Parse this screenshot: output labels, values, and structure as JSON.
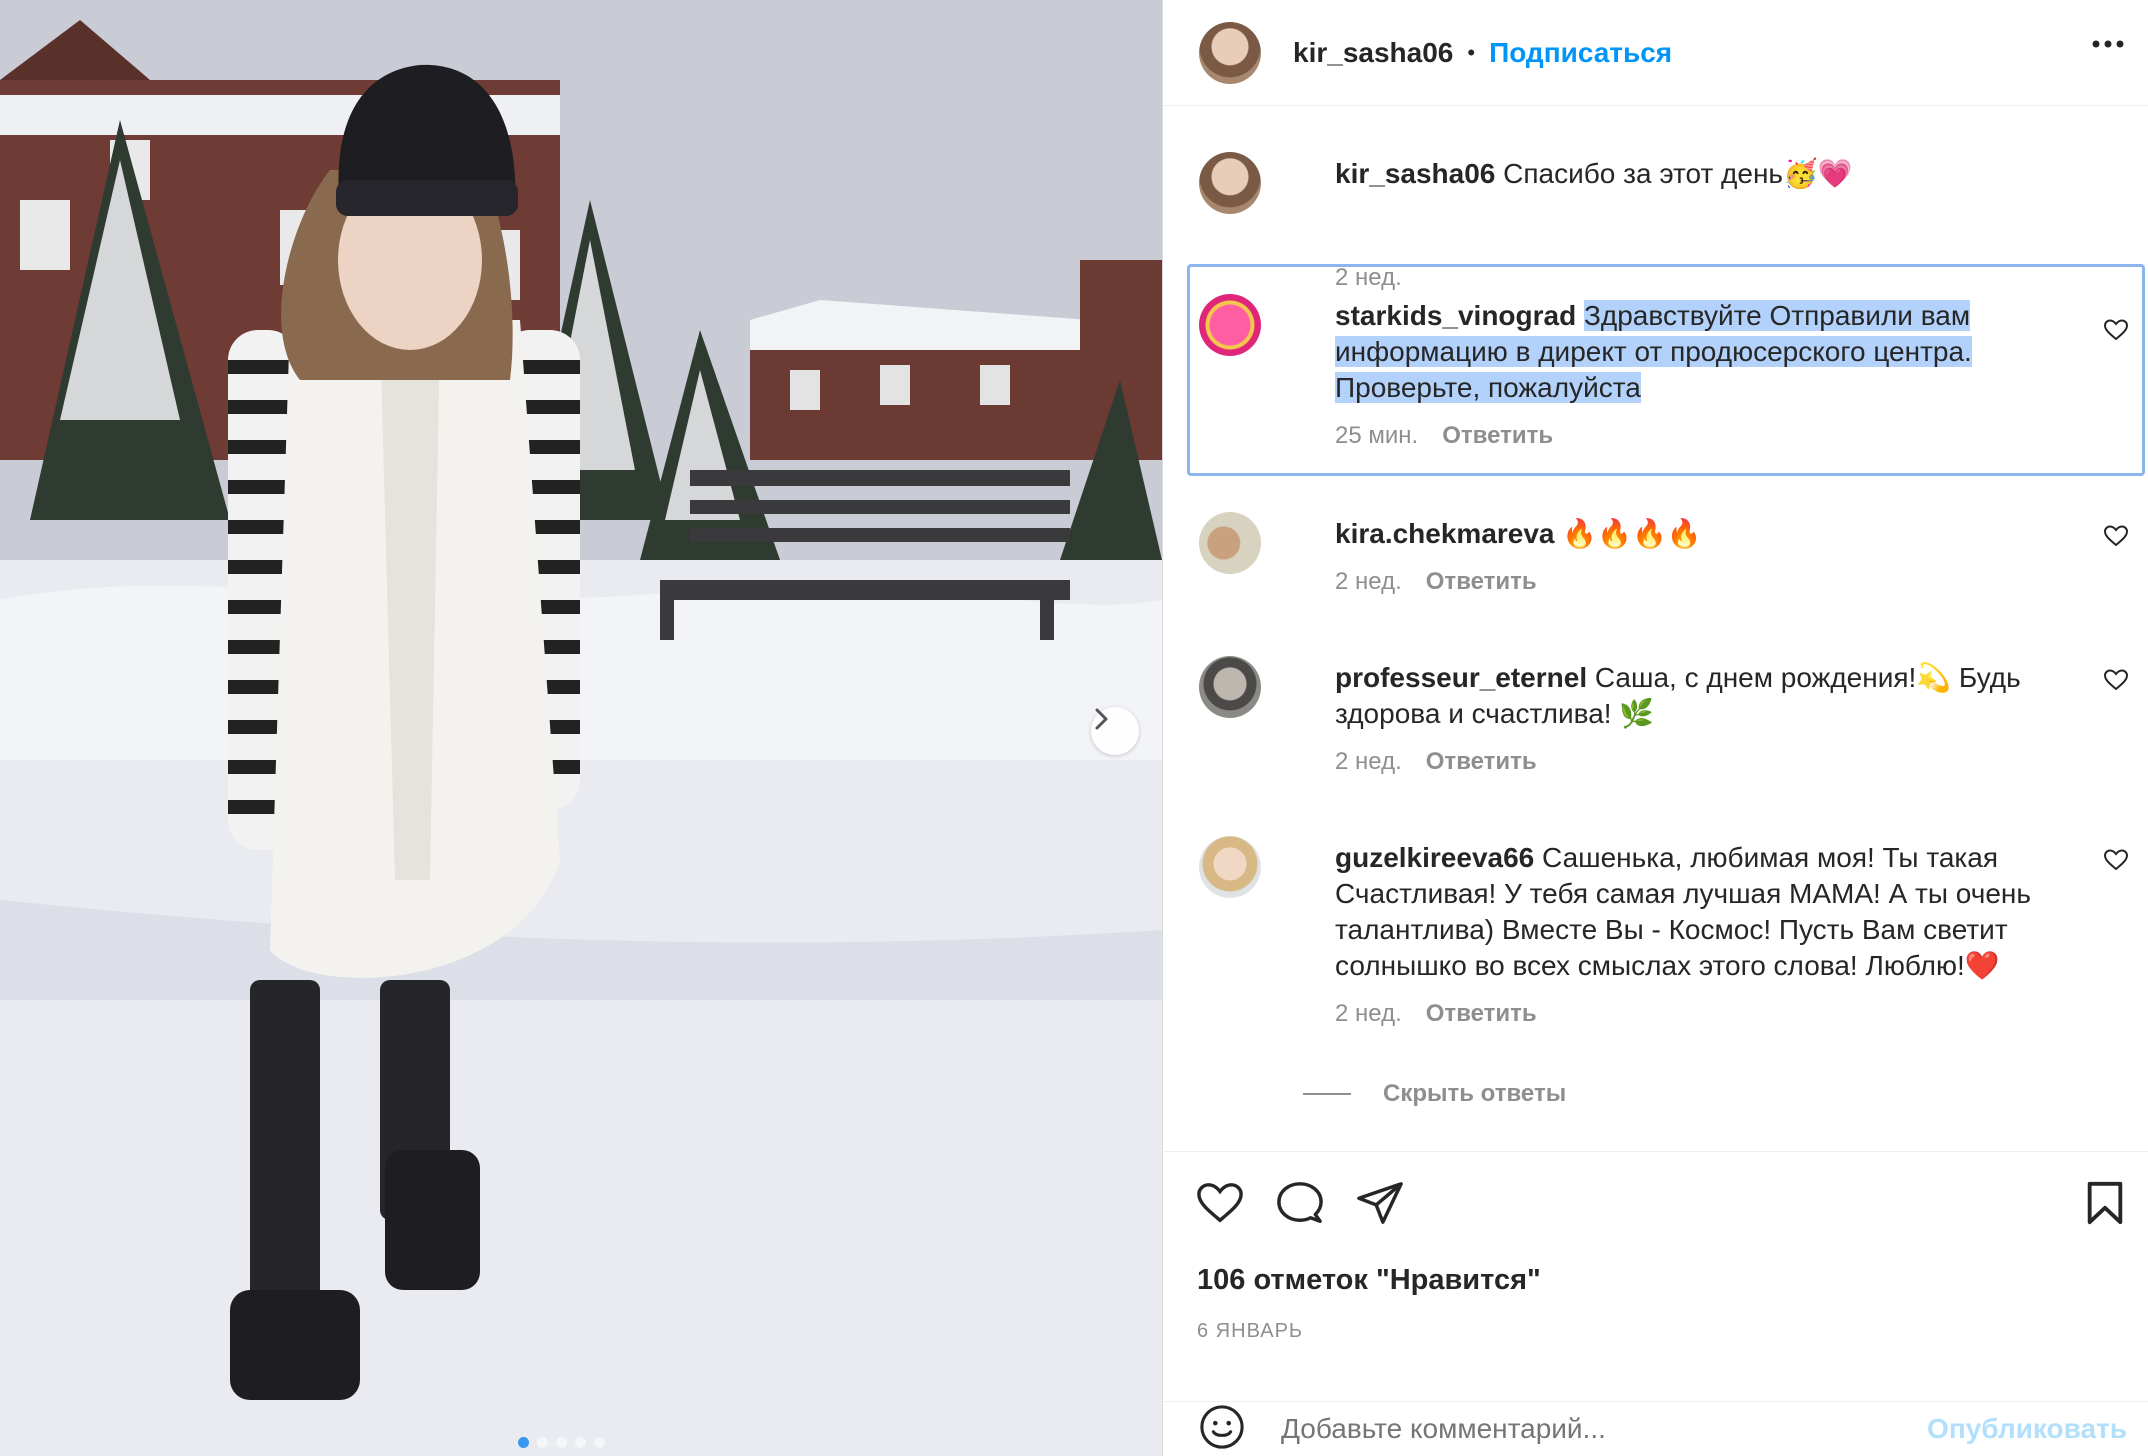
{
  "post": {
    "author": "kir_sasha06",
    "separator": "•",
    "follow_label": "Подписаться",
    "likes_text": "106 отметок \"Нравится\"",
    "date_text": "6 ЯНВАРЬ",
    "carousel_count": 5,
    "carousel_active": 0
  },
  "caption": {
    "user": "kir_sasha06",
    "text": "Спасибо за этот день🥳💗",
    "time": "2 нед."
  },
  "comments": [
    {
      "user": "starkids_vinograd",
      "text_line1": "Здравствуйте Отправили вам",
      "text_line2": "информацию в директ от продюсерского центра.",
      "text_line3": "Проверьте, пожалуйста",
      "time": "25 мин.",
      "reply": "Ответить"
    },
    {
      "user": "kira.chekmareva",
      "text": "🔥🔥🔥🔥",
      "time": "2 нед.",
      "reply": "Ответить"
    },
    {
      "user": "professeur_eternel",
      "text": "Саша, с днем рождения!💫 Будь здорова и счастлива! 🌿",
      "time": "2 нед.",
      "reply": "Ответить"
    },
    {
      "user": "guzelkireeva66",
      "text": "Сашенька, любимая моя! Ты такая Счастливая! У тебя самая лучшая МАМА! А ты очень талантлива) Вместе Вы - Космос! Пусть Вам светит солнышко во всех смыслах этого слова! Люблю!❤️",
      "time": "2 нед.",
      "reply": "Ответить"
    }
  ],
  "hide_replies_label": "Скрыть ответы",
  "composer": {
    "placeholder": "Добавьте комментарий...",
    "post_label": "Опубликовать"
  },
  "colors": {
    "accent": "#0095f6",
    "selection": "#b3d2fb",
    "muted": "#8e8e8e"
  }
}
